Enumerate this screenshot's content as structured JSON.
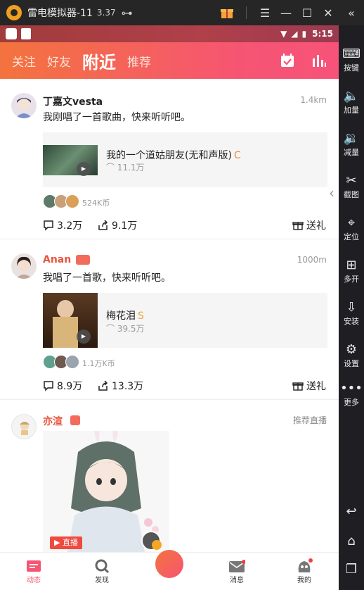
{
  "window": {
    "title": "雷电模拟器-11",
    "version": "3.37"
  },
  "status": {
    "time": "5:15"
  },
  "header": {
    "tabs": [
      {
        "label": "关注"
      },
      {
        "label": "好友"
      },
      {
        "label": "附近"
      },
      {
        "label": "推荐"
      }
    ]
  },
  "sidebar": {
    "items": [
      {
        "label": "按键",
        "icon": "keyboard-icon"
      },
      {
        "label": "加量",
        "icon": "volume-up-icon"
      },
      {
        "label": "减量",
        "icon": "volume-down-icon"
      },
      {
        "label": "截图",
        "icon": "scissors-icon"
      },
      {
        "label": "定位",
        "icon": "location-icon"
      },
      {
        "label": "多开",
        "icon": "multi-open-icon"
      },
      {
        "label": "安装",
        "icon": "apk-install-icon"
      },
      {
        "label": "设置",
        "icon": "gear-icon"
      },
      {
        "label": "更多",
        "icon": "more-icon"
      }
    ]
  },
  "posts": [
    {
      "username": "丁嘉文vesta",
      "distance": "1.4km",
      "text": "我刚唱了一首歌曲，快来听听吧。",
      "song_title": "我的一个道姑朋友(无和声版)",
      "song_badge": "C",
      "plays": "11.1万",
      "tips": "524K币",
      "comments": "3.2万",
      "shares": "9.1万",
      "gift": "送礼"
    },
    {
      "username": "Anan",
      "distance": "1000m",
      "text": "我唱了一首歌，快来听听吧。",
      "song_title": "梅花泪",
      "song_badge": "S",
      "plays": "39.5万",
      "tips": "1.1万K币",
      "comments": "8.9万",
      "shares": "13.3万",
      "gift": "送礼"
    },
    {
      "username": "亦渲",
      "live_label": "推荐直播",
      "live_badge": "直播"
    }
  ],
  "bottom_nav": [
    {
      "label": "动态",
      "icon": "feed-icon"
    },
    {
      "label": "发现",
      "icon": "discover-icon"
    },
    {
      "label": "",
      "icon": "sing-icon"
    },
    {
      "label": "消息",
      "icon": "message-icon"
    },
    {
      "label": "我的",
      "icon": "profile-icon"
    }
  ],
  "colors": {
    "accent": "#f65572",
    "accent_orange": "#f3733e",
    "username_red": "#e8553e"
  }
}
